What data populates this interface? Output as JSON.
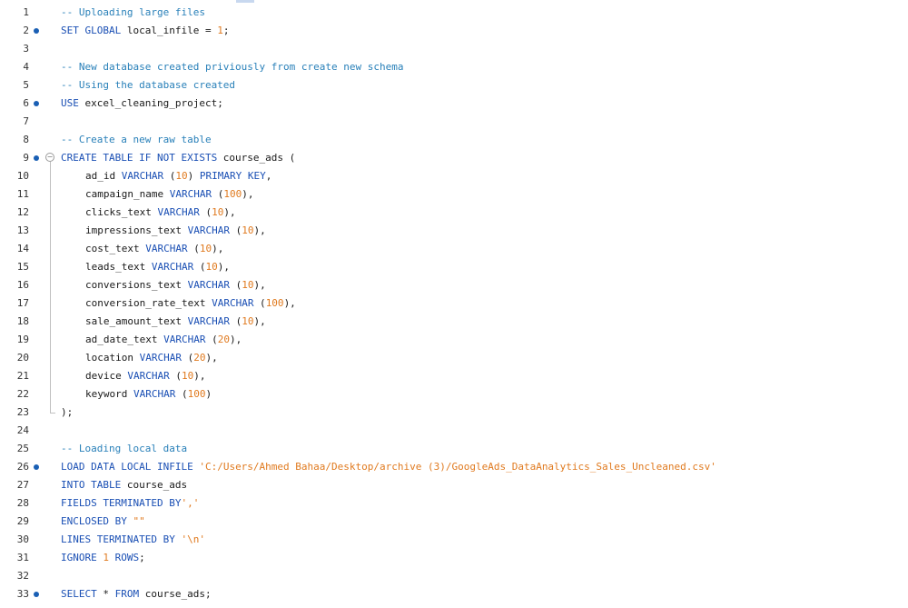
{
  "lines": [
    {
      "num": "1",
      "marker": false,
      "tokens": [
        {
          "t": "cm",
          "v": "-- Uploading large files"
        }
      ]
    },
    {
      "num": "2",
      "marker": true,
      "tokens": [
        {
          "t": "kw",
          "v": "SET GLOBAL"
        },
        {
          "t": "id",
          "v": " local_infile = "
        },
        {
          "t": "num",
          "v": "1"
        },
        {
          "t": "id",
          "v": ";"
        }
      ]
    },
    {
      "num": "3",
      "marker": false,
      "tokens": []
    },
    {
      "num": "4",
      "marker": false,
      "tokens": [
        {
          "t": "cm",
          "v": "-- New database created priviously from create new schema"
        }
      ]
    },
    {
      "num": "5",
      "marker": false,
      "tokens": [
        {
          "t": "cm",
          "v": "-- Using the database created"
        }
      ]
    },
    {
      "num": "6",
      "marker": true,
      "tokens": [
        {
          "t": "kw",
          "v": "USE"
        },
        {
          "t": "id",
          "v": " excel_cleaning_project;"
        }
      ]
    },
    {
      "num": "7",
      "marker": false,
      "tokens": []
    },
    {
      "num": "8",
      "marker": false,
      "tokens": [
        {
          "t": "cm",
          "v": "-- Create a new raw table"
        }
      ]
    },
    {
      "num": "9",
      "marker": true,
      "fold": "start",
      "tokens": [
        {
          "t": "kw",
          "v": "CREATE TABLE IF NOT EXISTS"
        },
        {
          "t": "id",
          "v": " course_ads ("
        }
      ]
    },
    {
      "num": "10",
      "marker": false,
      "indent": true,
      "tokens": [
        {
          "t": "id",
          "v": "ad_id "
        },
        {
          "t": "kw",
          "v": "VARCHAR"
        },
        {
          "t": "id",
          "v": " ("
        },
        {
          "t": "num",
          "v": "10"
        },
        {
          "t": "id",
          "v": ") "
        },
        {
          "t": "kw",
          "v": "PRIMARY KEY"
        },
        {
          "t": "id",
          "v": ","
        }
      ]
    },
    {
      "num": "11",
      "marker": false,
      "indent": true,
      "tokens": [
        {
          "t": "id",
          "v": "campaign_name "
        },
        {
          "t": "kw",
          "v": "VARCHAR"
        },
        {
          "t": "id",
          "v": " ("
        },
        {
          "t": "num",
          "v": "100"
        },
        {
          "t": "id",
          "v": "),"
        }
      ]
    },
    {
      "num": "12",
      "marker": false,
      "indent": true,
      "tokens": [
        {
          "t": "id",
          "v": "clicks_text "
        },
        {
          "t": "kw",
          "v": "VARCHAR"
        },
        {
          "t": "id",
          "v": " ("
        },
        {
          "t": "num",
          "v": "10"
        },
        {
          "t": "id",
          "v": "),"
        }
      ]
    },
    {
      "num": "13",
      "marker": false,
      "indent": true,
      "tokens": [
        {
          "t": "id",
          "v": "impressions_text "
        },
        {
          "t": "kw",
          "v": "VARCHAR"
        },
        {
          "t": "id",
          "v": " ("
        },
        {
          "t": "num",
          "v": "10"
        },
        {
          "t": "id",
          "v": "),"
        }
      ]
    },
    {
      "num": "14",
      "marker": false,
      "indent": true,
      "tokens": [
        {
          "t": "id",
          "v": "cost_text "
        },
        {
          "t": "kw",
          "v": "VARCHAR"
        },
        {
          "t": "id",
          "v": " ("
        },
        {
          "t": "num",
          "v": "10"
        },
        {
          "t": "id",
          "v": "),"
        }
      ]
    },
    {
      "num": "15",
      "marker": false,
      "indent": true,
      "tokens": [
        {
          "t": "id",
          "v": "leads_text "
        },
        {
          "t": "kw",
          "v": "VARCHAR"
        },
        {
          "t": "id",
          "v": " ("
        },
        {
          "t": "num",
          "v": "10"
        },
        {
          "t": "id",
          "v": "),"
        }
      ]
    },
    {
      "num": "16",
      "marker": false,
      "indent": true,
      "tokens": [
        {
          "t": "id",
          "v": "conversions_text "
        },
        {
          "t": "kw",
          "v": "VARCHAR"
        },
        {
          "t": "id",
          "v": " ("
        },
        {
          "t": "num",
          "v": "10"
        },
        {
          "t": "id",
          "v": "),"
        }
      ]
    },
    {
      "num": "17",
      "marker": false,
      "indent": true,
      "tokens": [
        {
          "t": "id",
          "v": "conversion_rate_text "
        },
        {
          "t": "kw",
          "v": "VARCHAR"
        },
        {
          "t": "id",
          "v": " ("
        },
        {
          "t": "num",
          "v": "100"
        },
        {
          "t": "id",
          "v": "),"
        }
      ]
    },
    {
      "num": "18",
      "marker": false,
      "indent": true,
      "tokens": [
        {
          "t": "id",
          "v": "sale_amount_text "
        },
        {
          "t": "kw",
          "v": "VARCHAR"
        },
        {
          "t": "id",
          "v": " ("
        },
        {
          "t": "num",
          "v": "10"
        },
        {
          "t": "id",
          "v": "),"
        }
      ]
    },
    {
      "num": "19",
      "marker": false,
      "indent": true,
      "tokens": [
        {
          "t": "id",
          "v": "ad_date_text "
        },
        {
          "t": "kw",
          "v": "VARCHAR"
        },
        {
          "t": "id",
          "v": " ("
        },
        {
          "t": "num",
          "v": "20"
        },
        {
          "t": "id",
          "v": "),"
        }
      ]
    },
    {
      "num": "20",
      "marker": false,
      "indent": true,
      "tokens": [
        {
          "t": "id",
          "v": "location "
        },
        {
          "t": "kw",
          "v": "VARCHAR"
        },
        {
          "t": "id",
          "v": " ("
        },
        {
          "t": "num",
          "v": "20"
        },
        {
          "t": "id",
          "v": "),"
        }
      ]
    },
    {
      "num": "21",
      "marker": false,
      "indent": true,
      "tokens": [
        {
          "t": "id",
          "v": "device "
        },
        {
          "t": "kw",
          "v": "VARCHAR"
        },
        {
          "t": "id",
          "v": " ("
        },
        {
          "t": "num",
          "v": "10"
        },
        {
          "t": "id",
          "v": "),"
        }
      ]
    },
    {
      "num": "22",
      "marker": false,
      "indent": true,
      "tokens": [
        {
          "t": "id",
          "v": "keyword "
        },
        {
          "t": "kw",
          "v": "VARCHAR"
        },
        {
          "t": "id",
          "v": " ("
        },
        {
          "t": "num",
          "v": "100"
        },
        {
          "t": "id",
          "v": ")"
        }
      ]
    },
    {
      "num": "23",
      "marker": false,
      "fold": "end",
      "tokens": [
        {
          "t": "id",
          "v": ");"
        }
      ]
    },
    {
      "num": "24",
      "marker": false,
      "tokens": []
    },
    {
      "num": "25",
      "marker": false,
      "tokens": [
        {
          "t": "cm",
          "v": "-- Loading local data"
        }
      ]
    },
    {
      "num": "26",
      "marker": true,
      "tokens": [
        {
          "t": "kw",
          "v": "LOAD DATA LOCAL INFILE"
        },
        {
          "t": "id",
          "v": " "
        },
        {
          "t": "str",
          "v": "'C:/Users/Ahmed Bahaa/Desktop/archive (3)/GoogleAds_DataAnalytics_Sales_Uncleaned.csv'"
        }
      ]
    },
    {
      "num": "27",
      "marker": false,
      "tokens": [
        {
          "t": "kw",
          "v": "INTO TABLE"
        },
        {
          "t": "id",
          "v": " course_ads"
        }
      ]
    },
    {
      "num": "28",
      "marker": false,
      "tokens": [
        {
          "t": "kw",
          "v": "FIELDS TERMINATED BY"
        },
        {
          "t": "str",
          "v": "','"
        }
      ]
    },
    {
      "num": "29",
      "marker": false,
      "tokens": [
        {
          "t": "kw",
          "v": "ENCLOSED BY"
        },
        {
          "t": "id",
          "v": " "
        },
        {
          "t": "str",
          "v": "\"\""
        }
      ]
    },
    {
      "num": "30",
      "marker": false,
      "tokens": [
        {
          "t": "kw",
          "v": "LINES TERMINATED BY"
        },
        {
          "t": "id",
          "v": " "
        },
        {
          "t": "str",
          "v": "'\\n'"
        }
      ]
    },
    {
      "num": "31",
      "marker": false,
      "tokens": [
        {
          "t": "kw",
          "v": "IGNORE"
        },
        {
          "t": "id",
          "v": " "
        },
        {
          "t": "num",
          "v": "1"
        },
        {
          "t": "id",
          "v": " "
        },
        {
          "t": "kw",
          "v": "ROWS"
        },
        {
          "t": "id",
          "v": ";"
        }
      ]
    },
    {
      "num": "32",
      "marker": false,
      "tokens": []
    },
    {
      "num": "33",
      "marker": true,
      "tokens": [
        {
          "t": "kw",
          "v": "SELECT"
        },
        {
          "t": "id",
          "v": " * "
        },
        {
          "t": "kw",
          "v": "FROM"
        },
        {
          "t": "id",
          "v": " course_ads;"
        }
      ]
    }
  ],
  "colors": {
    "comment": "#2980b9",
    "keyword": "#1a4fb4",
    "number": "#e07a1f",
    "marker": "#1a5fb4"
  },
  "icons": {
    "marker": "statement-dot-icon",
    "fold": "fold-collapse-icon"
  }
}
